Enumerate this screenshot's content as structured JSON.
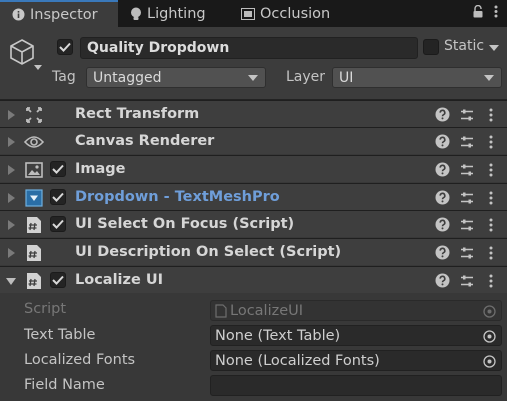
{
  "tabs": [
    {
      "label": "Inspector",
      "icon": "info-icon",
      "active": true
    },
    {
      "label": "Lighting",
      "icon": "lightbulb-icon",
      "active": false
    },
    {
      "label": "Occlusion",
      "icon": "occlusion-icon",
      "active": false
    }
  ],
  "header": {
    "object_name": "Quality Dropdown",
    "active": true,
    "static_label": "Static",
    "tag_label": "Tag",
    "tag_value": "Untagged",
    "layer_label": "Layer",
    "layer_value": "UI"
  },
  "components": [
    {
      "title": "Rect Transform",
      "icon": "rect-transform-icon",
      "has_checkbox": false,
      "expanded": false,
      "highlighted": false
    },
    {
      "title": "Canvas Renderer",
      "icon": "eye-icon",
      "has_checkbox": false,
      "expanded": false,
      "highlighted": false
    },
    {
      "title": "Image",
      "icon": "image-icon",
      "has_checkbox": true,
      "expanded": false,
      "highlighted": false
    },
    {
      "title": "Dropdown - TextMeshPro",
      "icon": "dropdown-icon",
      "has_checkbox": true,
      "expanded": false,
      "highlighted": true
    },
    {
      "title": "UI Select On Focus (Script)",
      "icon": "script-icon",
      "has_checkbox": true,
      "expanded": false,
      "highlighted": false
    },
    {
      "title": "UI Description On Select (Script)",
      "icon": "script-icon",
      "has_checkbox": false,
      "expanded": false,
      "highlighted": false
    },
    {
      "title": "Localize UI",
      "icon": "script-icon",
      "has_checkbox": true,
      "expanded": true,
      "highlighted": false
    }
  ],
  "properties": [
    {
      "label": "Script",
      "value": "LocalizeUI",
      "disabled": true
    },
    {
      "label": "Text Table",
      "value": "None (Text Table)",
      "disabled": false
    },
    {
      "label": "Localized Fonts",
      "value": "None (Localized Fonts)",
      "disabled": false
    },
    {
      "label": "Field Name",
      "value": "",
      "disabled": false
    }
  ],
  "colors": {
    "accent": "#3a79bb",
    "highlight_title": "#6f9ed9",
    "panel_bg": "#383838",
    "header_bg": "#3c3c3c"
  }
}
